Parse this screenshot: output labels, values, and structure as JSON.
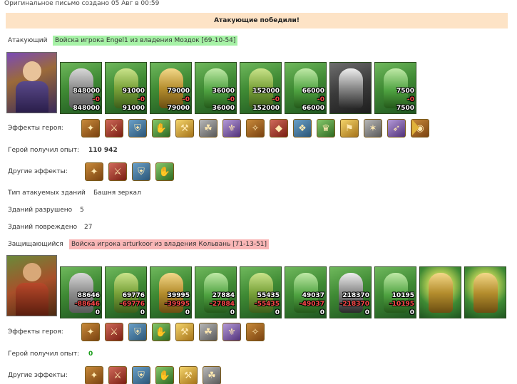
{
  "header": {
    "created": "Оригинальное письмо создано 05 Авг в 00:59",
    "result": "Атакующие победили!"
  },
  "attacker": {
    "label": "Атакующий",
    "tag": "Войска игрока Engel1 из владения Моздок [69-10-54]",
    "units": [
      {
        "icon": "dwarf-unit-icon",
        "n1": "848000",
        "n2": "-0",
        "n3": "848000"
      },
      {
        "icon": "knight-unit-icon",
        "n1": "91000",
        "n2": "-0",
        "n3": "91000"
      },
      {
        "icon": "paladin-unit-icon",
        "n1": "79000",
        "n2": "-0",
        "n3": "79000"
      },
      {
        "icon": "griffin-unit-icon",
        "n1": "36000",
        "n2": "-0",
        "n3": "36000"
      },
      {
        "icon": "archer-unit-icon",
        "n1": "152000",
        "n2": "-0",
        "n3": "152000"
      },
      {
        "icon": "elf-unit-icon",
        "n1": "66000",
        "n2": "-0",
        "n3": "66000"
      },
      {
        "icon": "monk-unit-icon",
        "n1": "",
        "n2": "",
        "n3": ""
      },
      {
        "icon": "druid-unit-icon",
        "n1": "7500",
        "n2": "-0",
        "n3": "7500"
      }
    ],
    "hero_effects_label": "Эффекты героя:",
    "hero_effects": [
      "chest-icon",
      "die-icon",
      "shield-icon",
      "gauntlet-icon",
      "sword-icon",
      "fist-icon",
      "hand-icon",
      "bag-icon",
      "helm-icon",
      "crystal-icon",
      "armor-icon",
      "banner-icon",
      "horn-icon",
      "dagger-icon",
      "coin-icon"
    ],
    "exp_label": "Герой получил опыт:",
    "exp_value": "110 942",
    "other_label": "Другие эффекты:",
    "other_effects": [
      "axe-icon",
      "sword-icon",
      "blade-icon",
      "saber-icon"
    ],
    "building_type_label": "Тип атакуемых зданий",
    "building_type_value": "Башня зеркал",
    "destroyed_label": "Зданий разрушено",
    "destroyed_value": "5",
    "damaged_label": "Зданий повреждено",
    "damaged_value": "27"
  },
  "defender": {
    "label": "Защищающийся",
    "tag": "Войска игрока arturkoor из владения Кольвань [71-13-51]",
    "units": [
      {
        "icon": "dwarf-unit-icon",
        "n1": "88646",
        "n2": "-88646",
        "n3": "0"
      },
      {
        "icon": "knight-unit-icon",
        "n1": "69776",
        "n2": "-69776",
        "n3": "0"
      },
      {
        "icon": "paladin-unit-icon",
        "n1": "39995",
        "n2": "-39995",
        "n3": "0"
      },
      {
        "icon": "griffin-unit-icon",
        "n1": "27884",
        "n2": "-27884",
        "n3": "0"
      },
      {
        "icon": "archer-unit-icon",
        "n1": "55435",
        "n2": "-55435",
        "n3": "0"
      },
      {
        "icon": "elf-unit-icon",
        "n1": "49037",
        "n2": "-49037",
        "n3": "0"
      },
      {
        "icon": "monk-unit-icon",
        "n1": "218370",
        "n2": "-218370",
        "n3": "0"
      },
      {
        "icon": "druid-unit-icon",
        "n1": "10195",
        "n2": "-10195",
        "n3": "0"
      },
      {
        "icon": "tower-unit-icon",
        "n1": "",
        "n2": "",
        "n3": ""
      },
      {
        "icon": "tower-unit-icon",
        "n1": "",
        "n2": "",
        "n3": ""
      }
    ],
    "hero_effects_label": "Эффекты героя:",
    "hero_effects": [
      "scroll-icon",
      "fruit-icon",
      "helm-icon",
      "claw-icon",
      "armor-icon",
      "mace-icon",
      "shield-icon",
      "pouch-icon"
    ],
    "exp_label": "Герой получил опыт:",
    "exp_value": "0",
    "other_label": "Другие эффекты:",
    "other_effects": [
      "totem-icon",
      "potion-icon",
      "chest-icon",
      "heart-icon",
      "staff-icon",
      "banner-icon"
    ]
  }
}
